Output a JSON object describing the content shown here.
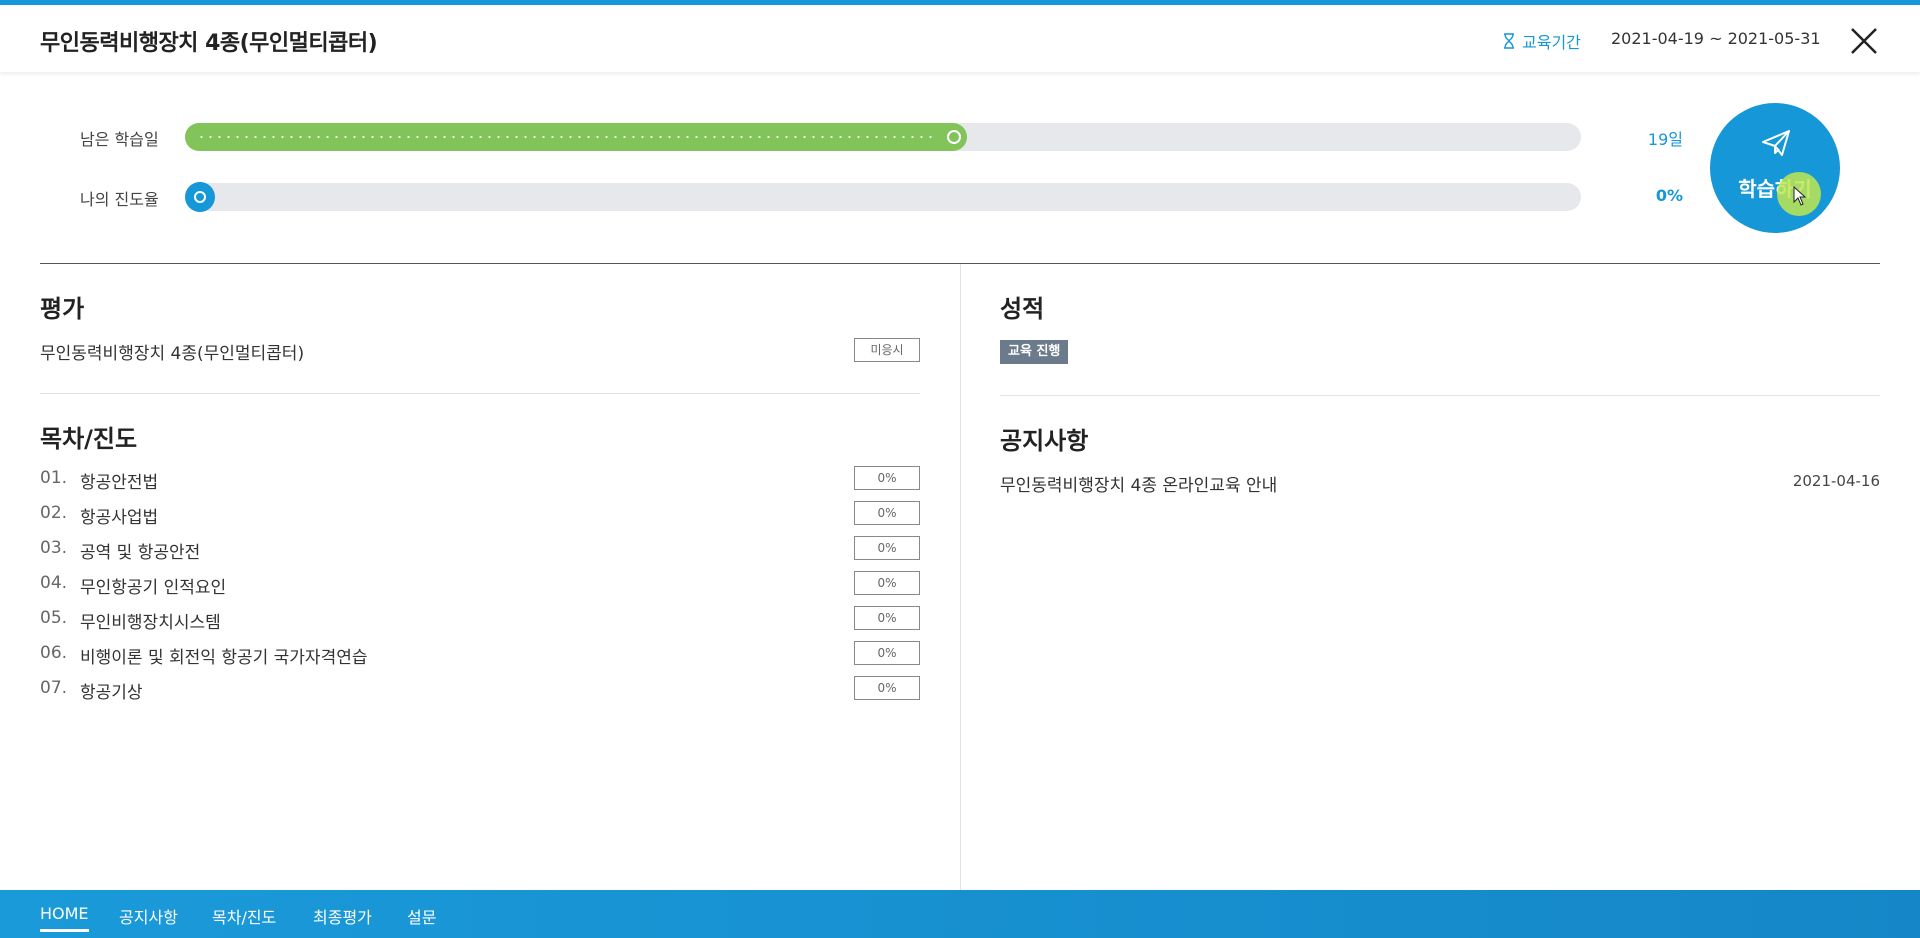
{
  "header": {
    "course_title": "무인동력비행장치 4종(무인멀티콥터)",
    "period_label": "교육기간",
    "period_dates": "2021-04-19 ~ 2021-05-31"
  },
  "progress": {
    "remaining_days": {
      "label": "남은 학습일",
      "value": "19일",
      "fraction": 0.56
    },
    "my_progress": {
      "label": "나의 진도율",
      "value": "0%",
      "fraction": 0.0
    }
  },
  "study_button": {
    "label": "학습하기"
  },
  "evaluation": {
    "title": "평가",
    "item": "무인동력비행장치 4종(무인멀티콥터)",
    "status": "미응시"
  },
  "toc": {
    "title": "목차/진도",
    "items": [
      {
        "num": "01.",
        "name": "항공안전법",
        "progress": "0%"
      },
      {
        "num": "02.",
        "name": "항공사업법",
        "progress": "0%"
      },
      {
        "num": "03.",
        "name": "공역 및 항공안전",
        "progress": "0%"
      },
      {
        "num": "04.",
        "name": "무인항공기 인적요인",
        "progress": "0%"
      },
      {
        "num": "05.",
        "name": "무인비행장치시스템",
        "progress": "0%"
      },
      {
        "num": "06.",
        "name": "비행이론 및 회전익 항공기 국가자격연습",
        "progress": "0%"
      },
      {
        "num": "07.",
        "name": "항공기상",
        "progress": "0%"
      }
    ]
  },
  "grades": {
    "title": "성적",
    "status": "교육 진행"
  },
  "notices": {
    "title": "공지사항",
    "items": [
      {
        "title": "무인동력비행장치 4종 온라인교육 안내",
        "date": "2021-04-16"
      }
    ]
  },
  "footer_nav": [
    "HOME",
    "공지사항",
    "목차/진도",
    "최종평가",
    "설문"
  ],
  "colors": {
    "accent": "#1597d8",
    "green": "#82c35a",
    "chip": "#6b7b8c"
  }
}
